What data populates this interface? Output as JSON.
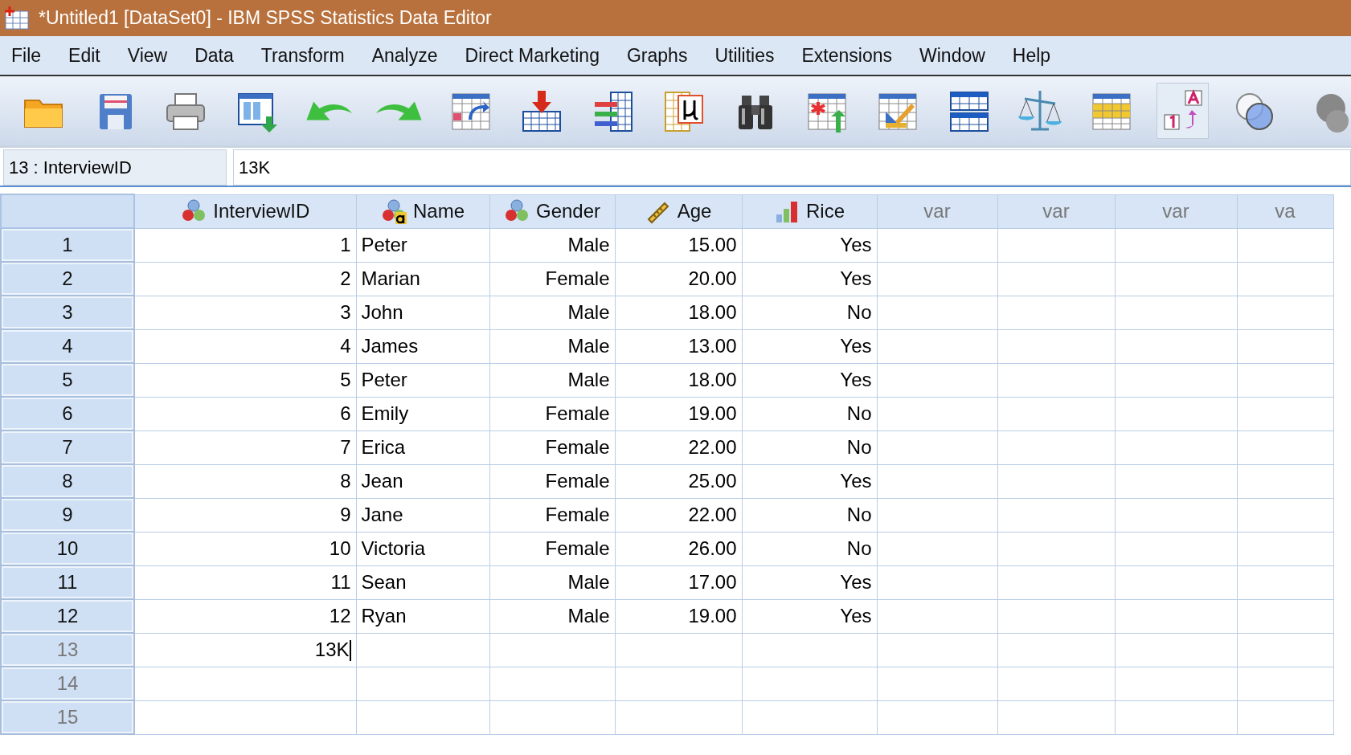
{
  "window": {
    "title": "*Untitled1 [DataSet0] - IBM SPSS Statistics Data Editor"
  },
  "menu": [
    "File",
    "Edit",
    "View",
    "Data",
    "Transform",
    "Analyze",
    "Direct Marketing",
    "Graphs",
    "Utilities",
    "Extensions",
    "Window",
    "Help"
  ],
  "toolbar": [
    {
      "kind": "open",
      "pressed": false
    },
    {
      "kind": "save",
      "pressed": false
    },
    {
      "kind": "print",
      "pressed": false
    },
    {
      "kind": "dialog",
      "pressed": false
    },
    {
      "kind": "undo",
      "pressed": false
    },
    {
      "kind": "redo",
      "pressed": false
    },
    {
      "kind": "gotocase",
      "pressed": false
    },
    {
      "kind": "insertcase",
      "pressed": false
    },
    {
      "kind": "variables",
      "pressed": false
    },
    {
      "kind": "mu",
      "pressed": false
    },
    {
      "kind": "find",
      "pressed": false
    },
    {
      "kind": "insertvar",
      "pressed": false
    },
    {
      "kind": "split",
      "pressed": false
    },
    {
      "kind": "splitgrid",
      "pressed": false
    },
    {
      "kind": "weight",
      "pressed": false
    },
    {
      "kind": "select",
      "pressed": false
    },
    {
      "kind": "labels",
      "pressed": true
    },
    {
      "kind": "sets",
      "pressed": false
    },
    {
      "kind": "blob",
      "pressed": false
    }
  ],
  "cell_editor": {
    "cell_name": "13 : InterviewID",
    "value": "13K"
  },
  "table": {
    "columns": [
      {
        "label": "InterviewID",
        "kind": "nominal"
      },
      {
        "label": "Name",
        "kind": "string"
      },
      {
        "label": "Gender",
        "kind": "nominal"
      },
      {
        "label": "Age",
        "kind": "scale"
      },
      {
        "label": "Rice",
        "kind": "ordinal"
      },
      {
        "label": "var",
        "kind": "empty"
      },
      {
        "label": "var",
        "kind": "empty"
      },
      {
        "label": "var",
        "kind": "empty"
      },
      {
        "label": "va",
        "kind": "empty"
      }
    ],
    "rows": [
      {
        "label": "1",
        "has_data": true,
        "cells": [
          "1",
          "Peter",
          "Male",
          "15.00",
          "Yes"
        ]
      },
      {
        "label": "2",
        "has_data": true,
        "cells": [
          "2",
          "Marian",
          "Female",
          "20.00",
          "Yes"
        ]
      },
      {
        "label": "3",
        "has_data": true,
        "cells": [
          "3",
          "John",
          "Male",
          "18.00",
          "No"
        ]
      },
      {
        "label": "4",
        "has_data": true,
        "cells": [
          "4",
          "James",
          "Male",
          "13.00",
          "Yes"
        ]
      },
      {
        "label": "5",
        "has_data": true,
        "cells": [
          "5",
          "Peter",
          "Male",
          "18.00",
          "Yes"
        ]
      },
      {
        "label": "6",
        "has_data": true,
        "cells": [
          "6",
          "Emily",
          "Female",
          "19.00",
          "No"
        ]
      },
      {
        "label": "7",
        "has_data": true,
        "cells": [
          "7",
          "Erica",
          "Female",
          "22.00",
          "No"
        ]
      },
      {
        "label": "8",
        "has_data": true,
        "cells": [
          "8",
          "Jean",
          "Female",
          "25.00",
          "Yes"
        ]
      },
      {
        "label": "9",
        "has_data": true,
        "cells": [
          "9",
          "Jane",
          "Female",
          "22.00",
          "No"
        ]
      },
      {
        "label": "10",
        "has_data": true,
        "cells": [
          "10",
          "Victoria",
          "Female",
          "26.00",
          "No"
        ]
      },
      {
        "label": "11",
        "has_data": true,
        "cells": [
          "11",
          "Sean",
          "Male",
          "17.00",
          "Yes"
        ]
      },
      {
        "label": "12",
        "has_data": true,
        "cells": [
          "12",
          "Ryan",
          "Male",
          "19.00",
          "Yes"
        ]
      },
      {
        "label": "13",
        "has_data": false,
        "editing": true,
        "cells": [
          "13K"
        ]
      },
      {
        "label": "14",
        "has_data": false,
        "cells": []
      },
      {
        "label": "15",
        "has_data": false,
        "cells": []
      }
    ]
  }
}
